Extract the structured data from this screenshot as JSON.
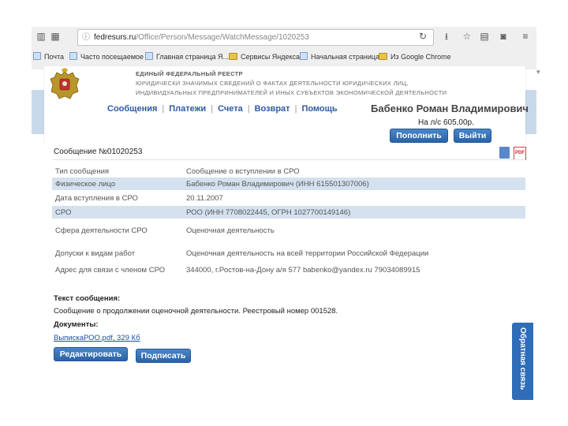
{
  "browser": {
    "url_host": "fedresurs.ru",
    "url_path": "/Office/Person/Message/WatchMessage/1020253",
    "bookmarks": [
      {
        "label": "Почта",
        "kind": "page"
      },
      {
        "label": "Часто посещаемое",
        "kind": "page"
      },
      {
        "label": "Главная страница Я...",
        "kind": "page"
      },
      {
        "label": "Сервисы Яндекса",
        "kind": "folder"
      },
      {
        "label": "Начальная страница",
        "kind": "page"
      },
      {
        "label": "Из Google Chrome",
        "kind": "folder"
      }
    ]
  },
  "header": {
    "registry_line1": "ЕДИНЫЙ ФЕДЕРАЛЬНЫЙ РЕЕСТР",
    "registry_line2": "ЮРИДИЧЕСКИ ЗНАЧИМЫХ СВЕДЕНИЙ О ФАКТАХ ДЕЯТЕЛЬНОСТИ ЮРИДИЧЕСКИХ ЛИЦ,",
    "registry_line3": "ИНДИВИДУАЛЬНЫХ ПРЕДПРИНИМАТЕЛЕЙ И ИНЫХ СУБЪЕКТОВ ЭКОНОМИЧЕСКОЙ ДЕЯТЕЛЬНОСТИ",
    "nav": [
      "Сообщения",
      "Платежи",
      "Счета",
      "Возврат",
      "Помощь"
    ],
    "user_name": "Бабенко Роман Владимирович",
    "balance": "На л/с 605,00р.",
    "topup_label": "Пополнить",
    "exit_label": "Выйти"
  },
  "message": {
    "title": "Сообщение №01020253",
    "rows": [
      {
        "key": "Тип сообщения",
        "value": "Сообщение о вступлении в СРО"
      },
      {
        "key": "Физическое лицо",
        "value": "Бабенко Роман Владимирович (ИНН 615501307006)"
      },
      {
        "key": "Дата вступления в СРО",
        "value": "20.11.2007"
      },
      {
        "key": "СРО",
        "value": "РОО (ИНН 7708022445, ОГРН 1027700149146)"
      },
      {
        "key": "Сфера деятельности СРО",
        "value": "Оценочная деятельность"
      },
      {
        "key": "Допуски к видам работ",
        "value": "Оценочная деятельность на всей территории Российской Федерации"
      },
      {
        "key": "Адрес для связи с членом СРО",
        "value": "344000, г.Ростов-на-Дону а/я 577 babenko@yandex.ru 79034089915"
      }
    ],
    "text_label": "Текст сообщения:",
    "text": "Сообщение о продолжении оценочной деятельности. Реестровый номер 001528.",
    "docs_label": "Документы:",
    "doc_link": "ВыпискаРОО.pdf, 329 Кб",
    "edit_label": "Редактировать",
    "sign_label": "Подписать",
    "pdf_icon_text": "PDF"
  },
  "side_tab": "Обратная связь"
}
